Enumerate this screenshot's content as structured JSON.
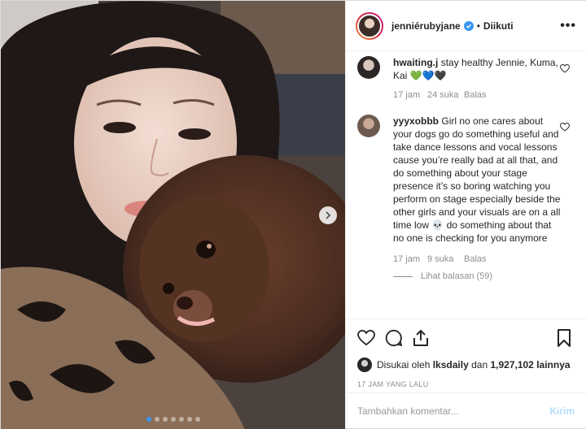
{
  "post": {
    "username": "jenniérubyjane",
    "separator": "•",
    "follow_status": "Diikuti",
    "more_icon": "ellipsis-icon"
  },
  "comments": [
    {
      "user": "hwaiting.j",
      "text": "stay healthy Jennie, Kuma, Kai 💚💙🖤",
      "time": "17 jam",
      "likes": "24 suka",
      "reply": "Balas"
    },
    {
      "user": "yyyxobbb",
      "text": "Girl no one cares about your dogs go do something useful and take dance lessons and vocal lessons cause you’re really bad at all that, and do something about your stage presence it’s so boring watching you perform on stage especially beside the other girls and your visuals are on a all time low 💀 do something about that no one is checking for you anymore",
      "time": "17 jam",
      "likes": "9 suka",
      "reply": "Balas",
      "view_replies": "Lihat balasan (59)"
    }
  ],
  "actions": {
    "liked_prefix": "Disukai oleh",
    "liked_user": "lksdaily",
    "liked_and": "dan",
    "liked_count": "1,927,102 lainnya",
    "timestamp": "17 JAM YANG LALU"
  },
  "composer": {
    "placeholder": "Tambahkan komentar...",
    "send_label": "Kirim"
  },
  "carousel": {
    "total_slides": 7,
    "active_index": 0
  },
  "colors": {
    "accent": "#3897f0",
    "send_disabled": "#b2dffc",
    "muted": "#8e8e8e"
  }
}
